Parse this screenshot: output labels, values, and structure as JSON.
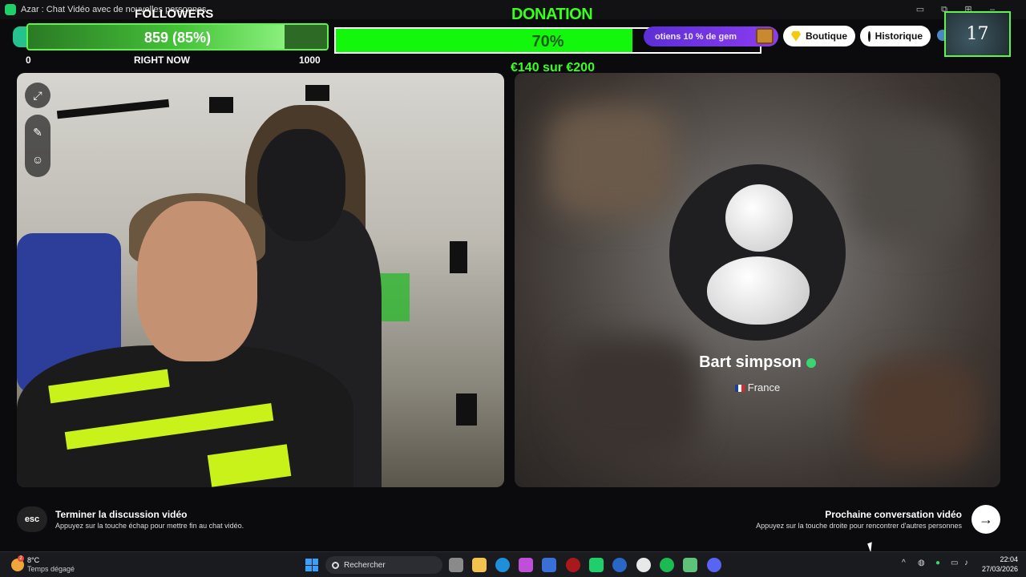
{
  "window": {
    "title": "Azar : Chat Vidéo avec de nouvelles personnes"
  },
  "followers": {
    "title": "FOLLOWERS",
    "value_text": "859 (85%)",
    "progress": 0.859,
    "min_label": "0",
    "mid_label": "RIGHT NOW",
    "max_label": "1000"
  },
  "donation": {
    "title": "DONATION",
    "percent_text": "70%",
    "progress": 0.7,
    "amount_text": "€140 sur €200"
  },
  "promo": {
    "text": "otiens 10 % de gem"
  },
  "header": {
    "shop_label": "Boutique",
    "history_label": "Historique",
    "avatar_count": "17"
  },
  "peer": {
    "name": "Bart simpson",
    "country": "France"
  },
  "footer": {
    "end_key": "esc",
    "end_title": "Terminer la discussion vidéo",
    "end_hint": "Appuyez sur la touche échap pour mettre fin au chat vidéo.",
    "next_title": "Prochaine conversation vidéo",
    "next_hint": "Appuyez sur la touche droite pour rencontrer d'autres personnes"
  },
  "taskbar": {
    "weather_badge": "2",
    "temperature": "8°C",
    "weather_desc": "Temps dégagé",
    "search_placeholder": "Rechercher",
    "time": "22:04",
    "date": "27/03/2026"
  },
  "colors": {
    "followers_accent": "#5cf54a",
    "donation_fill": "#12f70c",
    "donation_text": "#38ff1e",
    "promo": "#7a35e8"
  }
}
